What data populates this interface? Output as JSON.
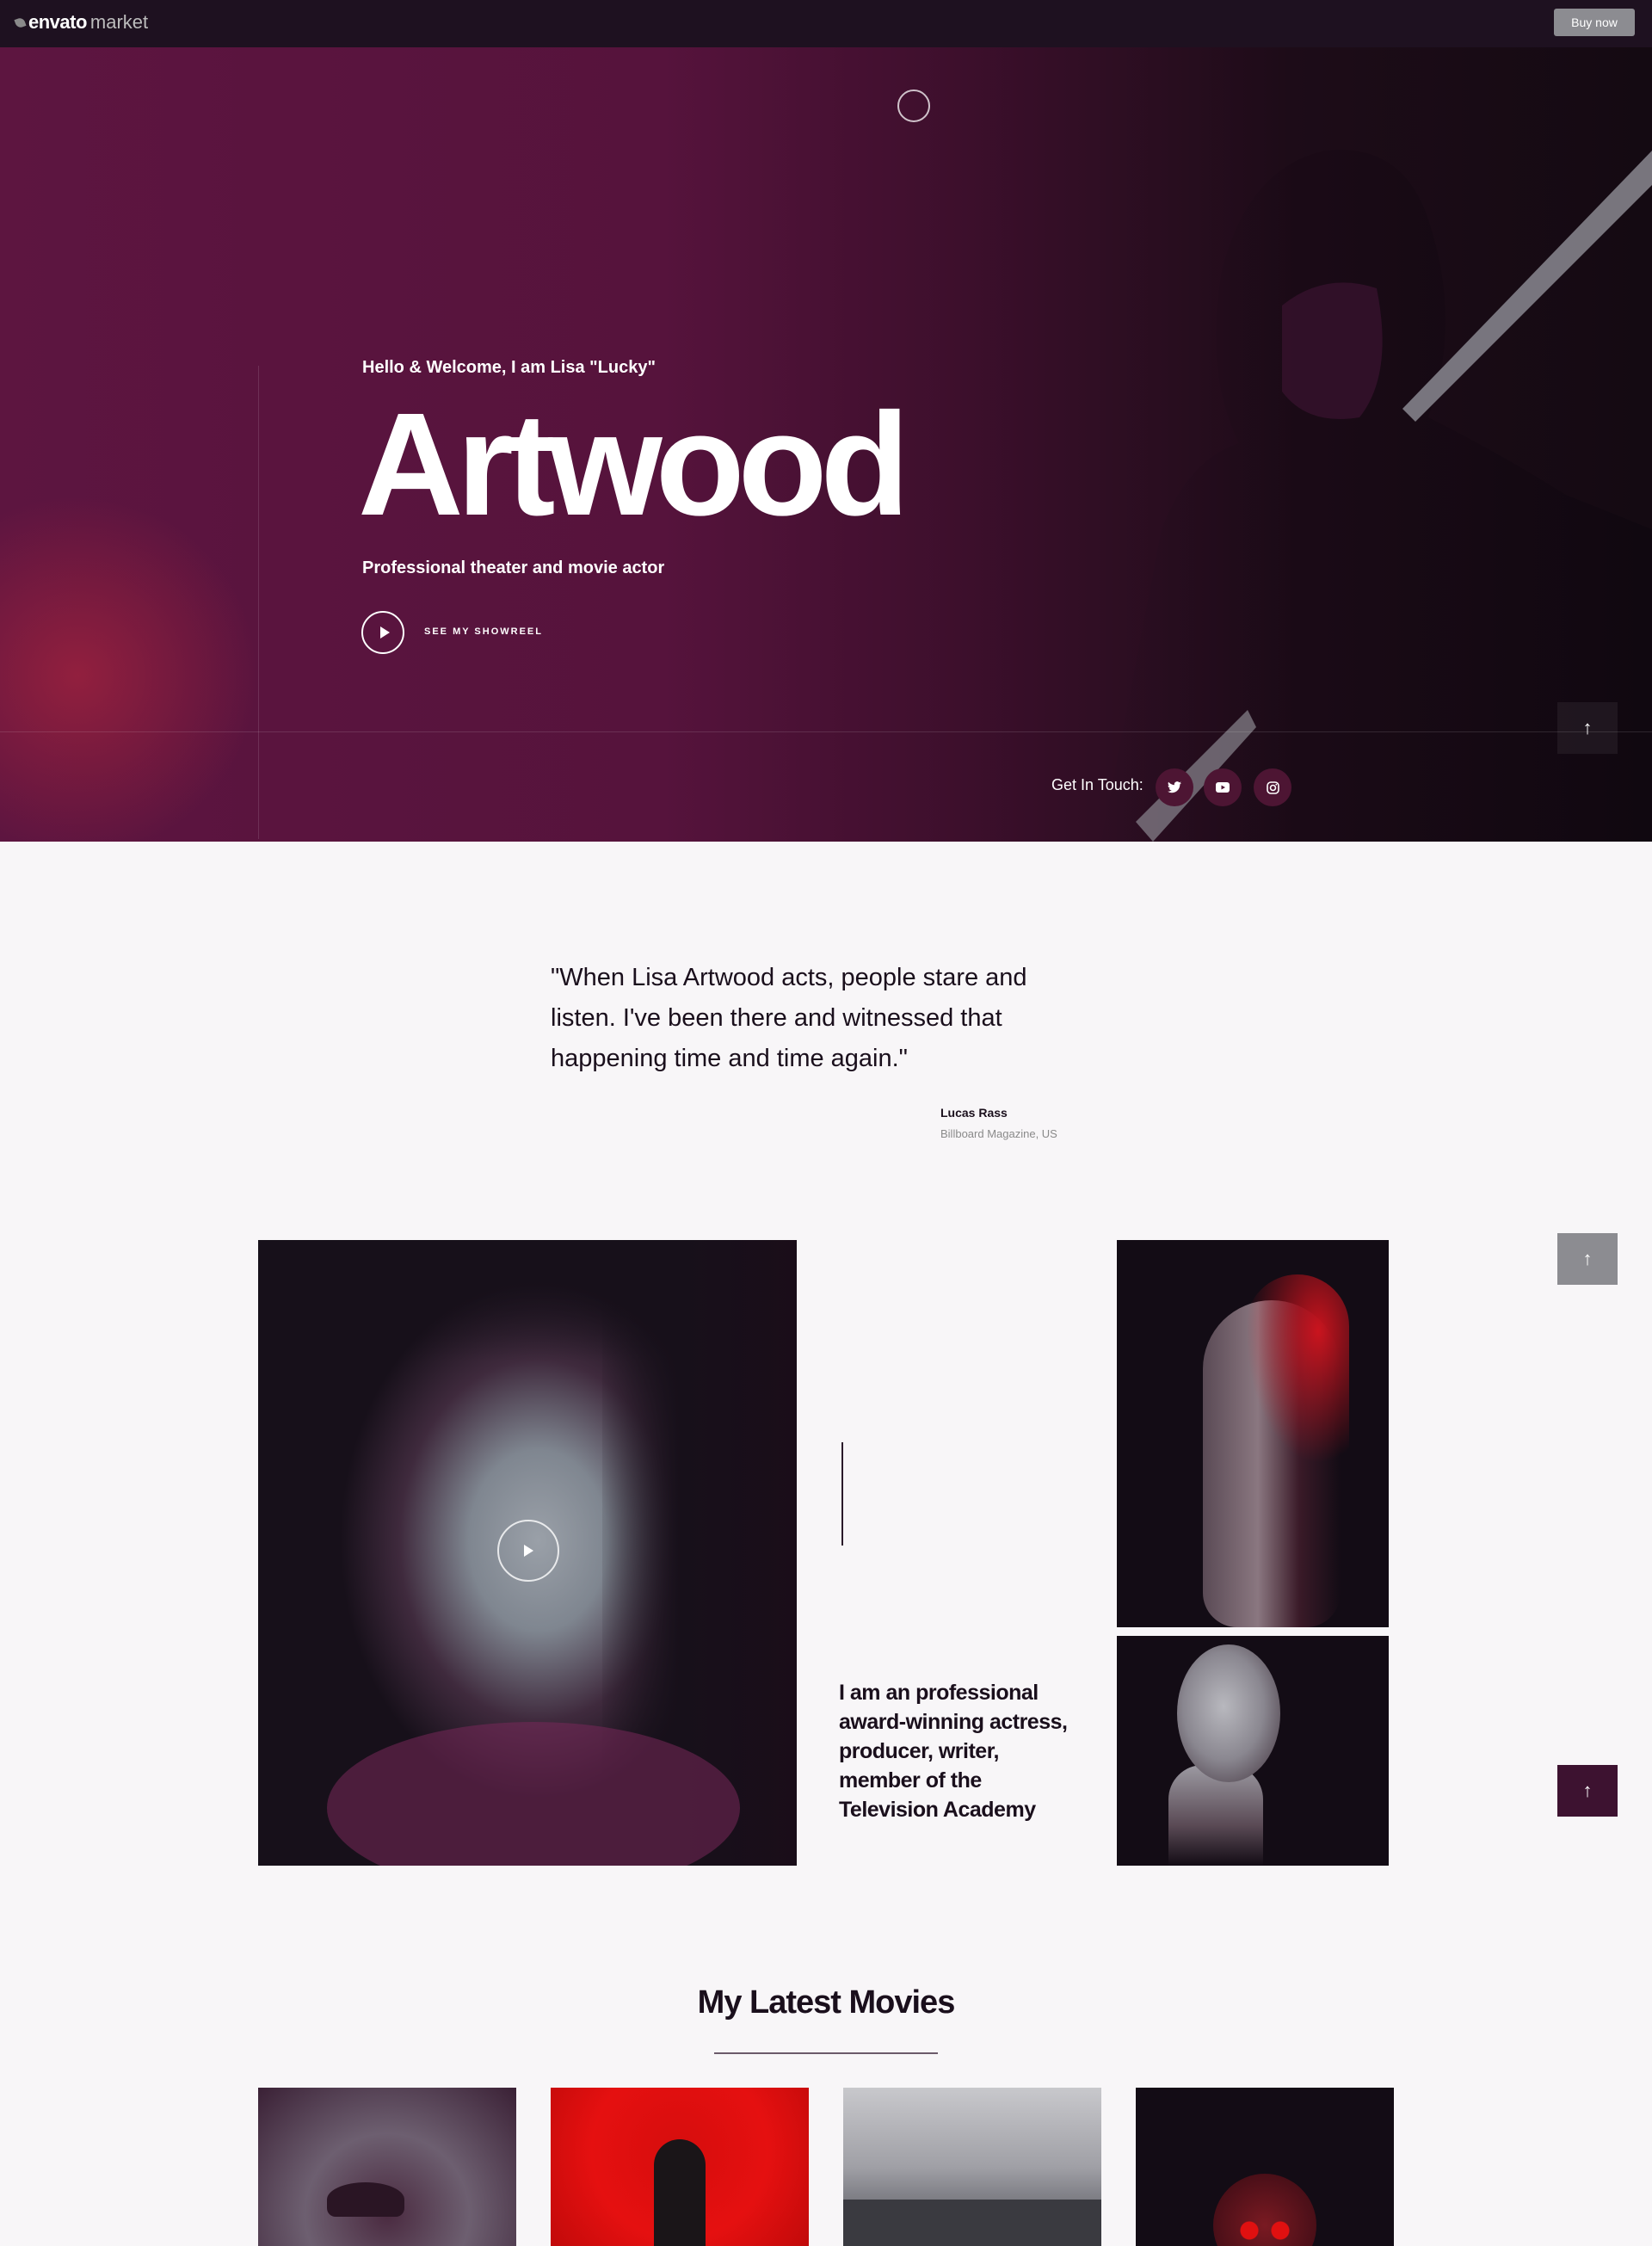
{
  "topbar": {
    "logo_brand": "envato",
    "logo_suffix": "market",
    "buy_label": "Buy now"
  },
  "hero": {
    "greeting": "Hello & Welcome, I am Lisa \"Lucky\"",
    "title": "Artwood",
    "subtitle": "Professional theater and movie actor",
    "showreel_label": "SEE MY SHOWREEL",
    "get_in_touch": "Get In Touch:",
    "socials": [
      "twitter-icon",
      "youtube-icon",
      "instagram-icon"
    ],
    "up_arrow": "↑"
  },
  "quote": {
    "text": "\"When Lisa Artwood acts, people stare and listen. I've been there and witnessed that happening time and time again.\"",
    "author": "Lucas Rass",
    "source": "Billboard Magazine, US"
  },
  "gallery": {
    "bio": "I am an professional award-winning actress, producer, writer, member of the Television Academy",
    "up_arrow": "↑"
  },
  "movies": {
    "title": "My Latest Movies"
  },
  "colors": {
    "hero_bg": "#56133c",
    "accent_dark": "#3d1230",
    "text_dark": "#1a0f1c",
    "gray_button": "#8c8c91"
  }
}
